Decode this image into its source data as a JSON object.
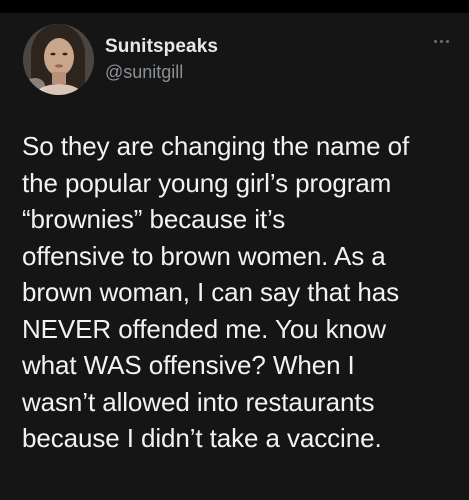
{
  "tweet": {
    "author": {
      "display_name": "Sunitspeaks",
      "handle": "@sunitgill",
      "avatar_icon": "profile-photo"
    },
    "more_icon": "more-horizontal-icon",
    "text": "So they are changing the name of\nthe popular young girl’s program\n“brownies” because it’s\noffensive to brown women. As a\nbrown woman, I can say that has\nNEVER offended me. You know\nwhat WAS offensive? When I\nwasn’t allowed into restaurants\nbecause I didn’t take a vaccine."
  },
  "colors": {
    "background": "#000000",
    "card": "#151515",
    "text_primary": "#e7e9ea",
    "text_secondary": "#8b9095"
  }
}
